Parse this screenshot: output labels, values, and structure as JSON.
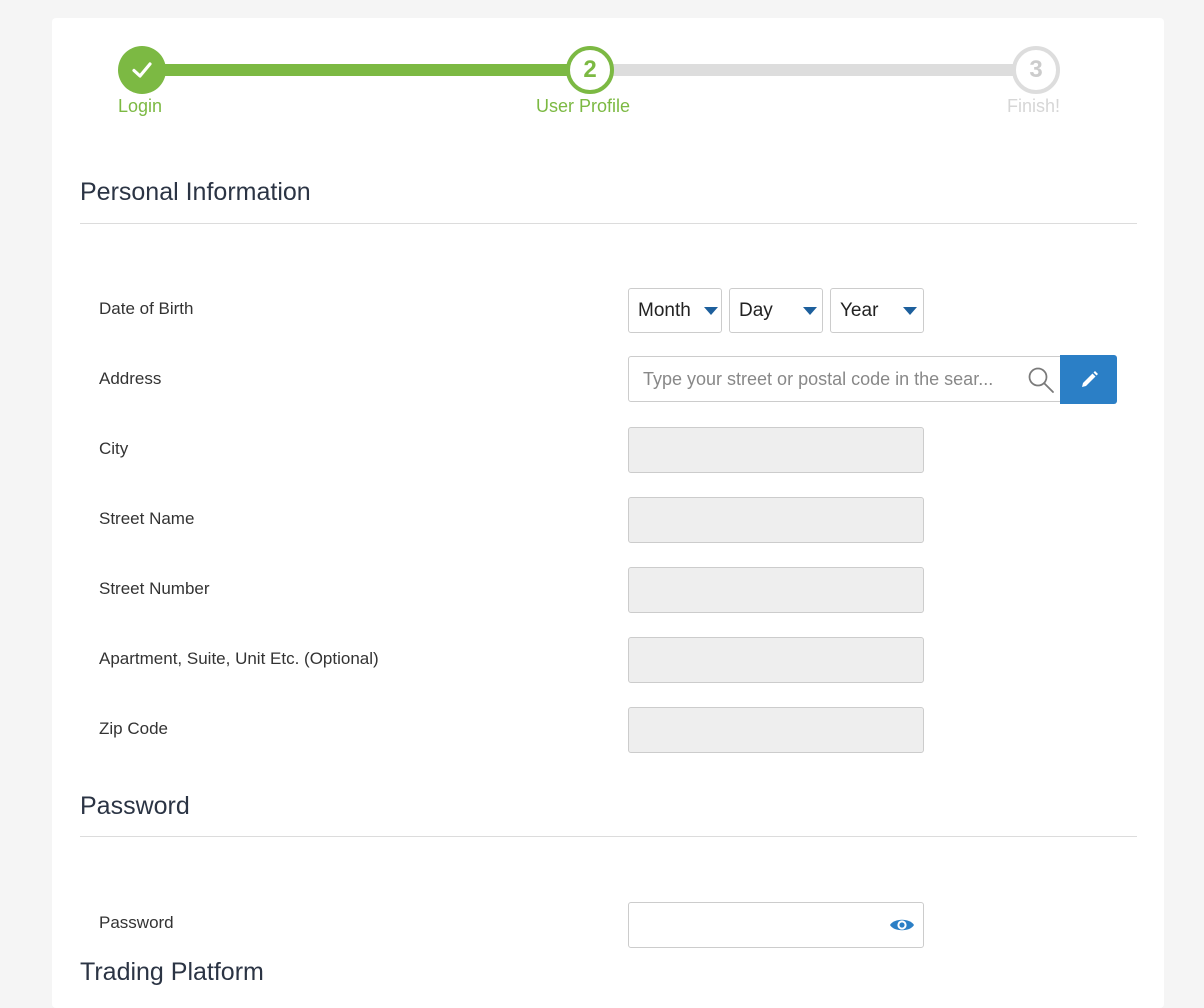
{
  "wizard": {
    "steps": [
      {
        "number": "✓",
        "label": "Login",
        "state": "done"
      },
      {
        "number": "2",
        "label": "User Profile",
        "state": "active"
      },
      {
        "number": "3",
        "label": "Finish!",
        "state": "pending"
      }
    ]
  },
  "personal": {
    "title": "Personal Information",
    "dob_label": "Date of Birth",
    "month": "Month",
    "day": "Day",
    "year": "Year",
    "address_label": "Address",
    "address_placeholder": "Type your street or postal code in the sear...",
    "city_label": "City",
    "street_name_label": "Street Name",
    "street_number_label": "Street Number",
    "apartment_label": "Apartment, Suite, Unit Etc. (Optional)",
    "zip_label": "Zip Code"
  },
  "password": {
    "title": "Password",
    "label": "Password"
  },
  "trading": {
    "title": "Trading Platform"
  },
  "colors": {
    "accent_green": "#7cb943",
    "button_blue": "#2b7fc6",
    "caret_blue": "#1d5f9c"
  }
}
